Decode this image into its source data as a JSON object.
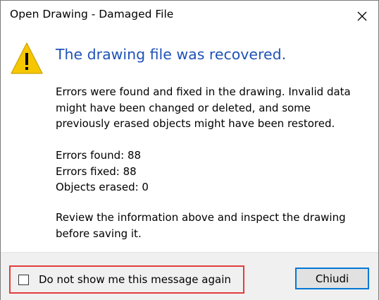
{
  "window": {
    "title": "Open Drawing - Damaged File",
    "close_icon": "close-icon"
  },
  "message": {
    "icon": "warning-icon",
    "heading": "The drawing file was recovered.",
    "body_lines": [
      "Errors were found and fixed in the drawing. Invalid data",
      "might have been changed or deleted, and some",
      "previously erased objects might have been restored."
    ],
    "stats": [
      "Errors found:  88",
      "Errors fixed:  88",
      "Objects erased:  0"
    ],
    "review_lines": [
      "Review the information above and inspect the drawing",
      "before saving it."
    ]
  },
  "footer": {
    "checkbox_label": "Do not show me this message again",
    "checkbox_checked": false,
    "button_label": "Chiudi"
  },
  "colors": {
    "heading": "#1e52b8",
    "highlight_border": "#e23d3d",
    "button_focus": "#0078d7",
    "warning_fill": "#f6c700"
  }
}
